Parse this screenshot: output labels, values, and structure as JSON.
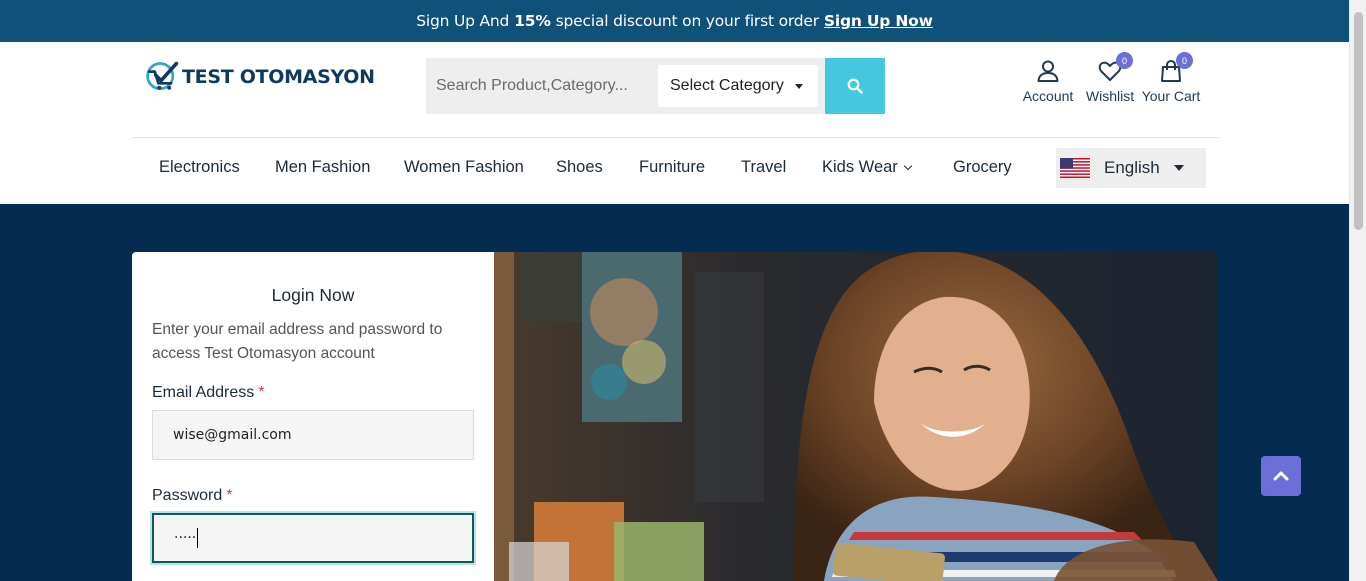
{
  "promo": {
    "text_before": "Sign Up And",
    "highlight": "15%",
    "text_after": "special discount on your first order",
    "link": "Sign Up Now"
  },
  "brand": {
    "name": "TEST OTOMASYON"
  },
  "search": {
    "placeholder": "Search Product,Category...",
    "category_selected": "Select Category",
    "icon": "search-icon"
  },
  "header_actions": [
    {
      "label": "Account",
      "icon": "user-icon"
    },
    {
      "label": "Wishlist",
      "icon": "heart-icon",
      "count": "0"
    },
    {
      "label": "Your Cart",
      "icon": "shopping-bag-icon",
      "count": "0"
    }
  ],
  "nav": {
    "items": [
      "Electronics",
      "Men Fashion",
      "Women Fashion",
      "Shoes",
      "Furniture",
      "Travel",
      "Kids Wear",
      "Grocery"
    ]
  },
  "language": {
    "selected": "English",
    "icon": "us-flag-icon"
  },
  "login": {
    "title": "Login Now",
    "description": "Enter your email address and password to access Test Otomasyon account",
    "email_label": "Email Address",
    "email_value": "wise@gmail.com",
    "password_label": "Password",
    "password_value": "·····",
    "required_mark": "*"
  },
  "colors": {
    "promo_bar": "#0f5178",
    "hero_bg": "#052c50",
    "search_button": "#44c8e0",
    "accent": "#6b6fd6"
  }
}
